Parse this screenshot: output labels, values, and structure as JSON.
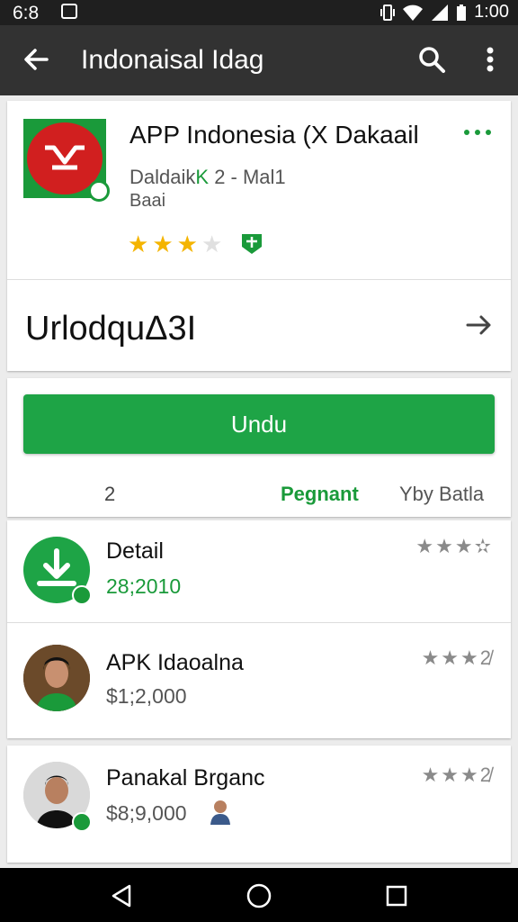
{
  "status_bar": {
    "time_left": "6:8",
    "time_right": "1:00"
  },
  "app_bar": {
    "title": "Indonaisal Idag"
  },
  "app": {
    "name": "APP Indonesia (X Dakaail",
    "developer": "Daldaik",
    "developer_highlight": "K",
    "developer_suffix": "2 - Mal1",
    "category": "Baai",
    "rating_filled": 3,
    "rating_total": 5
  },
  "section": {
    "label": "UrlodquΔ3I"
  },
  "install": {
    "button_label": "Undu"
  },
  "info": {
    "count": "2",
    "label_green": "Pegnant",
    "label_right": "Yby Batla"
  },
  "list_items": [
    {
      "name": "Detail",
      "price": "28;2010",
      "rating": "★★★",
      "rating_suffix": "✫",
      "price_color": "green"
    },
    {
      "name": "APK Idaoalna",
      "price": "$1;2,000",
      "rating": "★★★",
      "rating_suffix": "2̸"
    },
    {
      "name": "Panakal Brganc",
      "price": "$8;9,000",
      "rating": "★★★",
      "rating_suffix": "2̸"
    }
  ],
  "colors": {
    "accent_green": "#1ea446",
    "app_bar": "#323232",
    "status_bar": "#1f1f1f",
    "star_yellow": "#f4b400",
    "icon_red": "#d11f1f"
  },
  "icons": {
    "back": "arrow-left-icon",
    "search": "search-icon",
    "more": "more-vert-icon",
    "forward": "arrow-right-icon",
    "download": "download-icon",
    "nav_back": "triangle-back-icon",
    "nav_home": "circle-home-icon",
    "nav_recent": "square-recent-icon"
  }
}
